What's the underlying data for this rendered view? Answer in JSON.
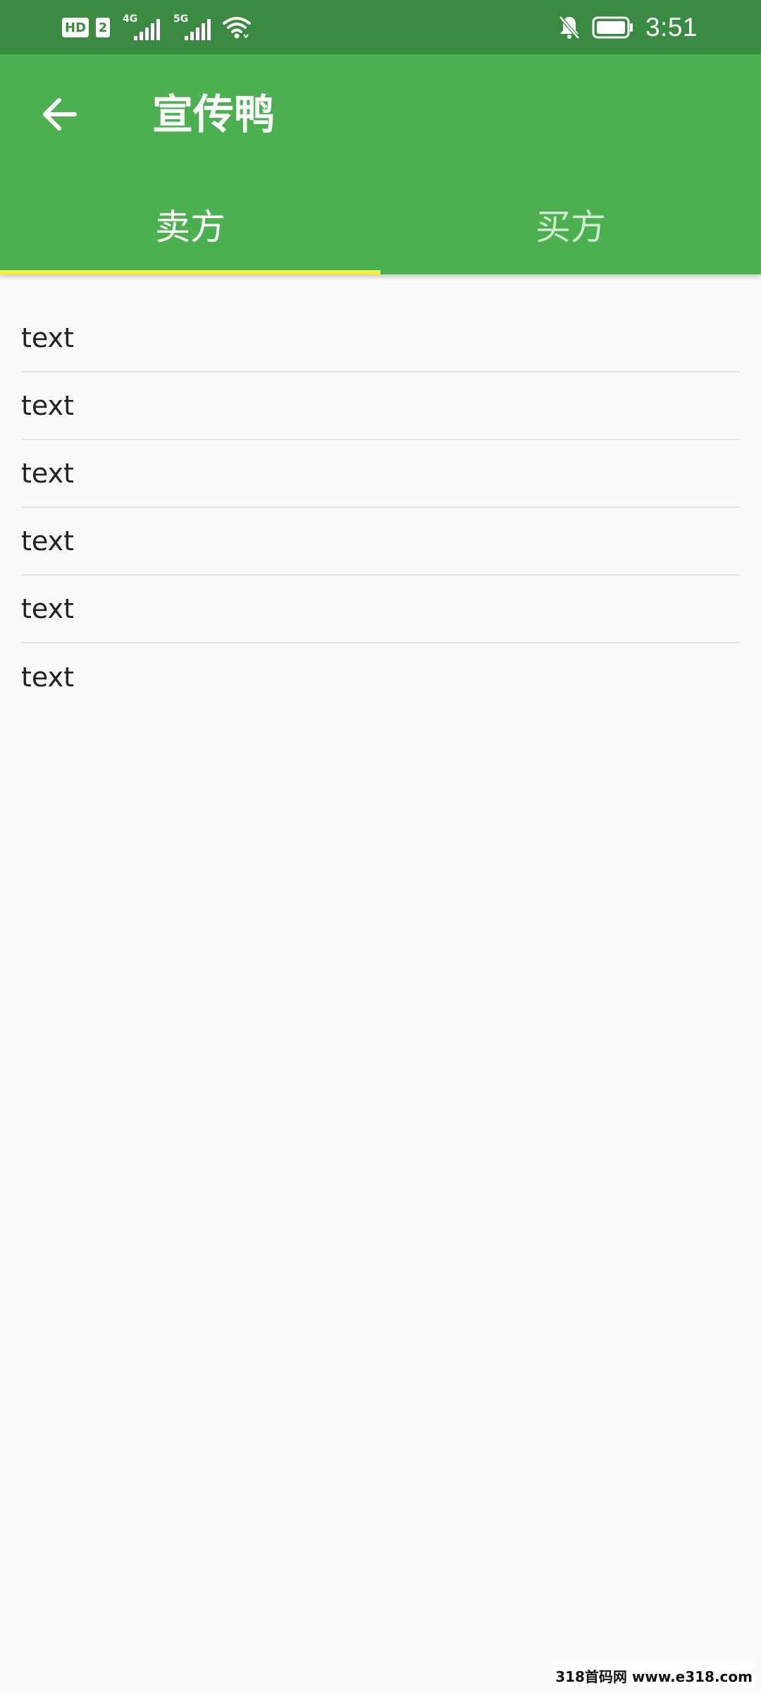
{
  "status_bar": {
    "hd_label": "HD",
    "sim_label": "2",
    "net1_label": "4G",
    "net2_label": "5G",
    "time": "3:51",
    "icons": [
      "signal-icon",
      "wifi-icon",
      "bell-muted-icon",
      "battery-icon"
    ]
  },
  "app_bar": {
    "title": "宣传鸭",
    "back_icon": "arrow-left-icon",
    "bg_color": "#4caf50",
    "tabs": [
      {
        "label": "卖方",
        "selected": true
      },
      {
        "label": "买方",
        "selected": false
      }
    ],
    "indicator_color": "#ffeb3b"
  },
  "list": {
    "items": [
      "text",
      "text",
      "text",
      "text",
      "text",
      "text"
    ]
  },
  "watermark": "318首码网 www.e318.com"
}
